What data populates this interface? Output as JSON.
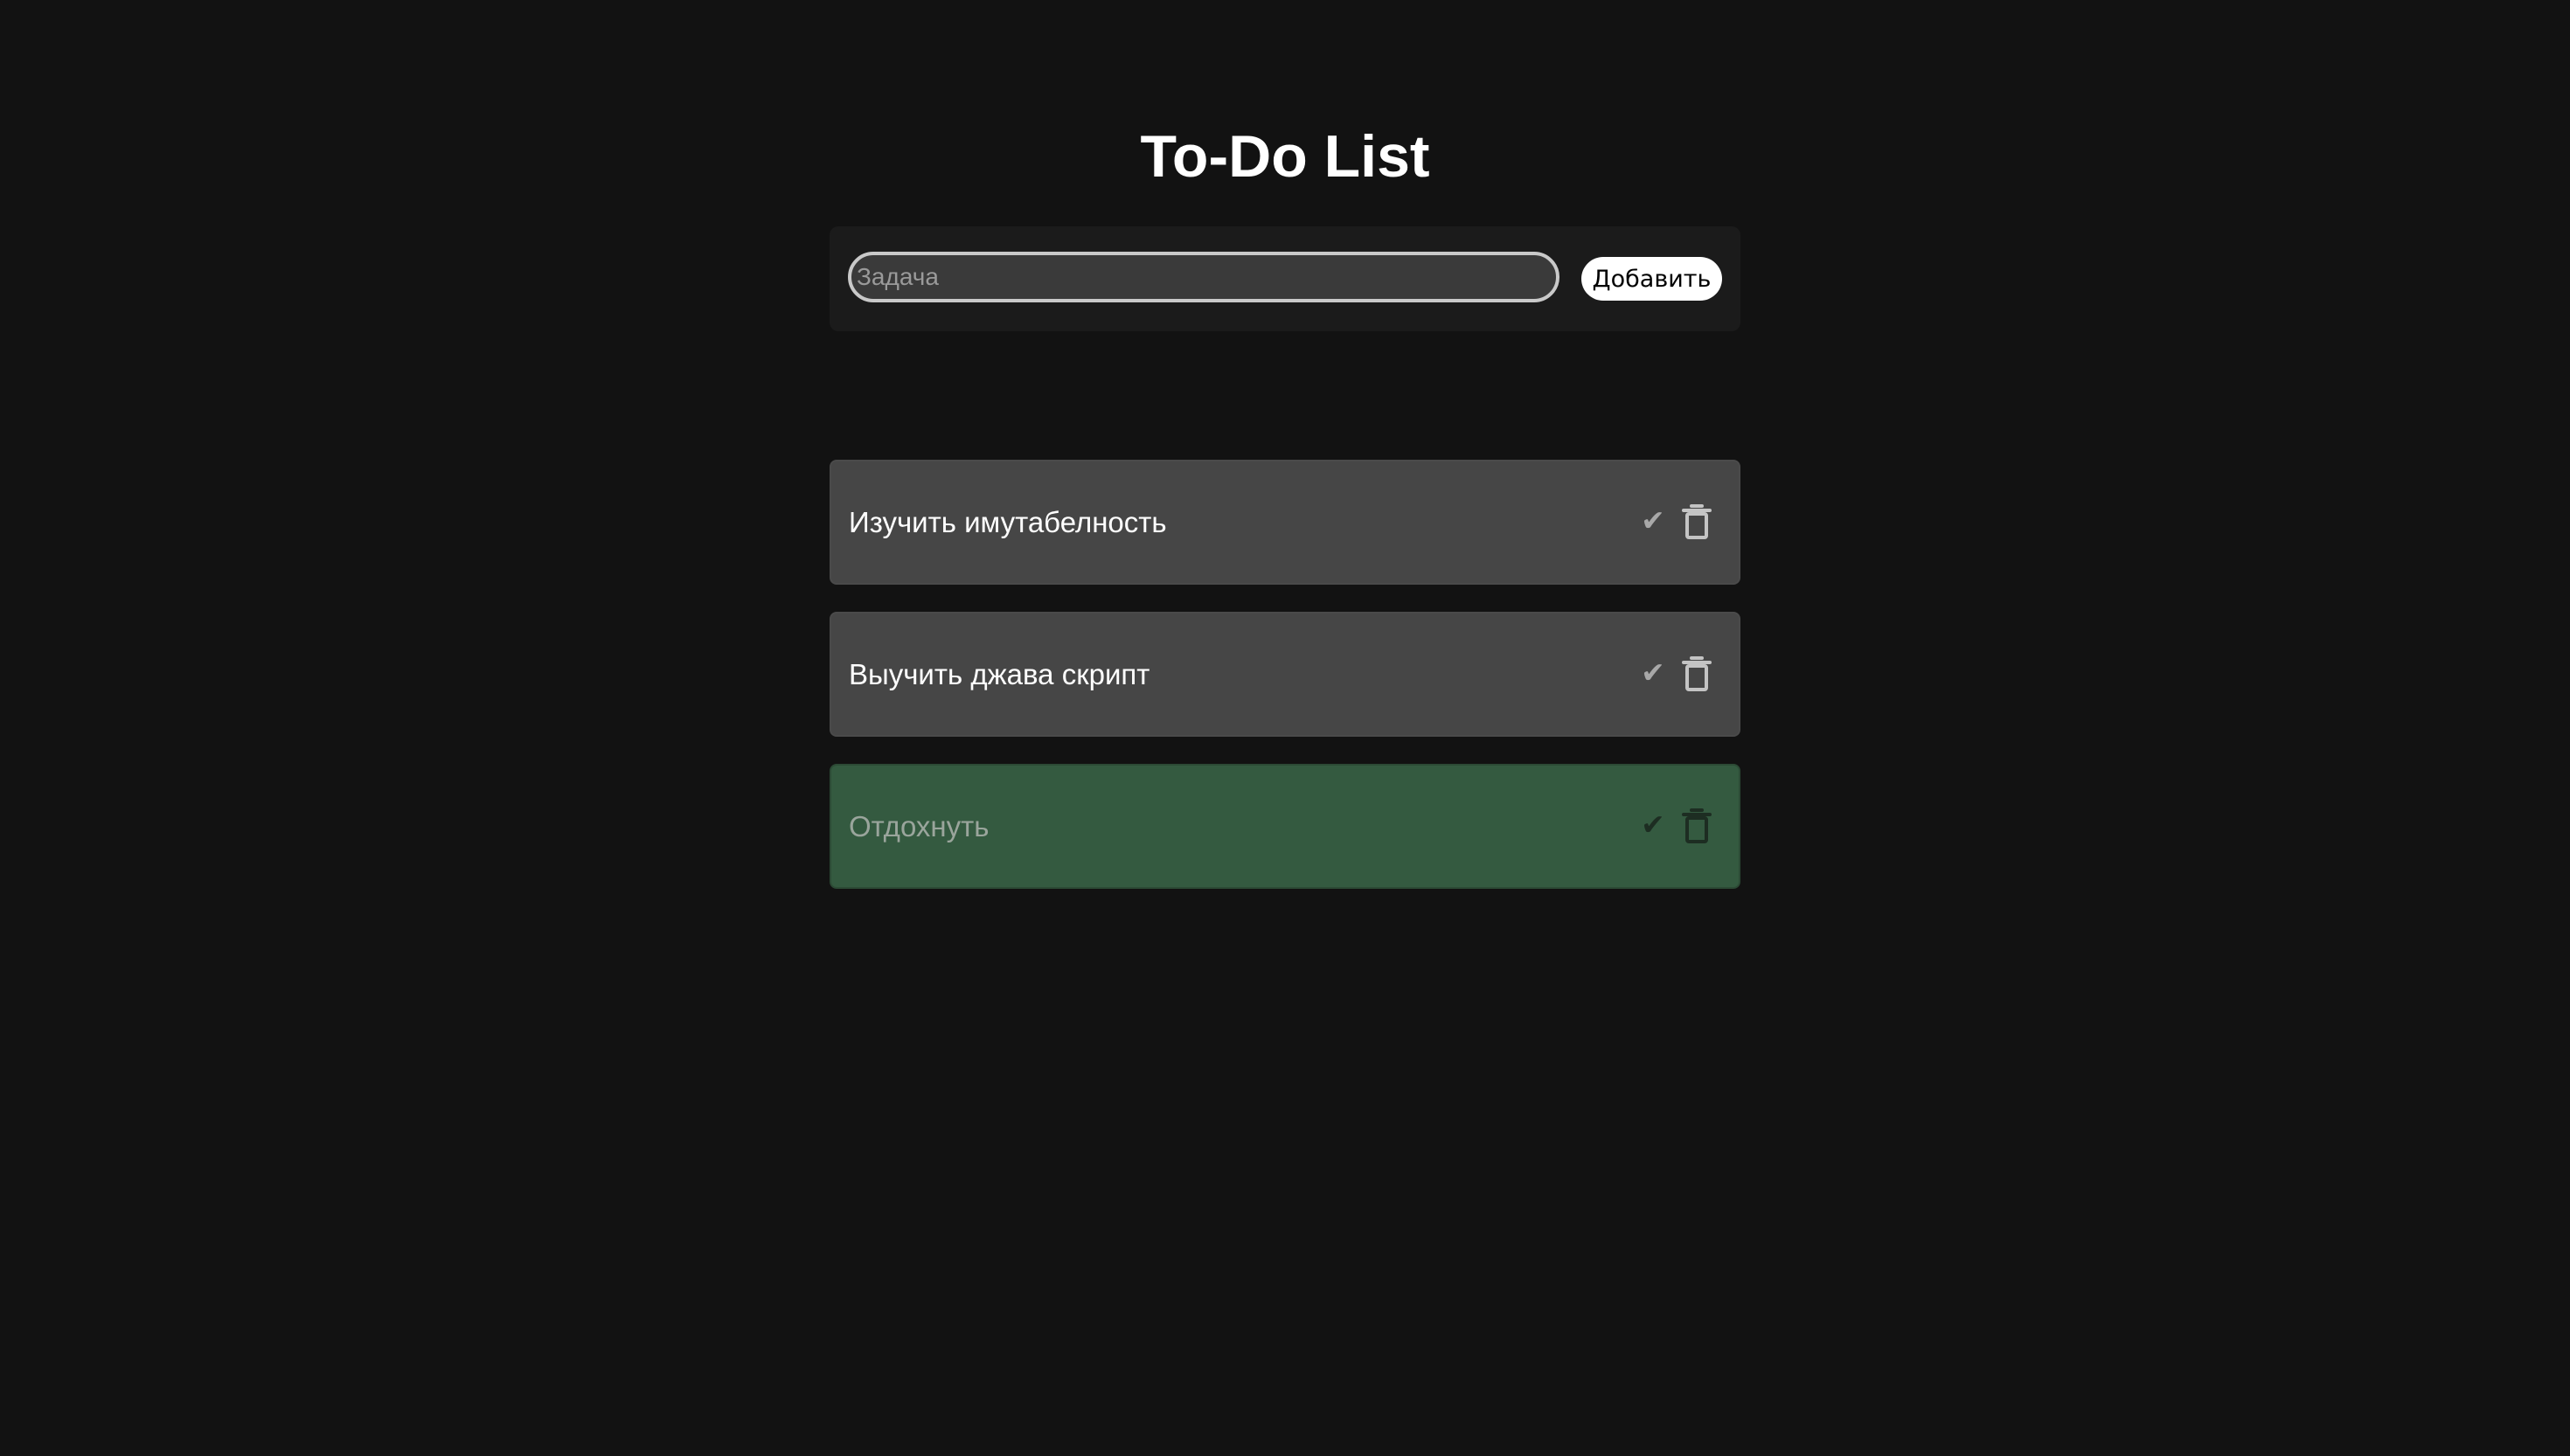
{
  "header": {
    "title": "To-Do List"
  },
  "form": {
    "input_placeholder": "Задача",
    "input_value": "",
    "add_label": "Добавить"
  },
  "tasks": [
    {
      "text": "Изучить имутабелность",
      "done": false,
      "check_icon": "✔",
      "delete_icon": "trash-icon"
    },
    {
      "text": "Выучить джава скрипт",
      "done": false,
      "check_icon": "✔",
      "delete_icon": "trash-icon"
    },
    {
      "text": "Отдохнуть",
      "done": true,
      "check_icon": "✔",
      "delete_icon": "trash-icon"
    }
  ],
  "colors": {
    "background": "#121212",
    "task_bg": "#464646",
    "task_done_bg": "#345a40",
    "accent": "#ffffff"
  }
}
